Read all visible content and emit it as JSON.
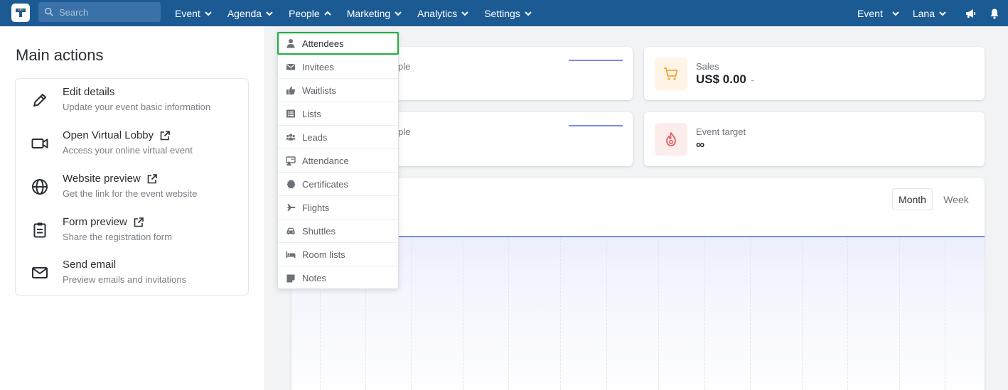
{
  "search": {
    "placeholder": "Search"
  },
  "nav": {
    "event": "Event",
    "agenda": "Agenda",
    "people": "People",
    "marketing": "Marketing",
    "analytics": "Analytics",
    "settings": "Settings"
  },
  "right_nav": {
    "event": "Event",
    "user": "Lana"
  },
  "main_actions": {
    "title": "Main actions",
    "items": [
      {
        "title": "Edit details",
        "subtitle": "Update your event basic information",
        "icon": "pencil-icon"
      },
      {
        "title": "Open Virtual Lobby",
        "subtitle": "Access your online virtual event",
        "icon": "video-camera-icon",
        "external": true
      },
      {
        "title": "Website preview",
        "subtitle": "Get the link for the event website",
        "icon": "globe-icon",
        "external": true
      },
      {
        "title": "Form preview",
        "subtitle": "Share the registration form",
        "icon": "clipboard-icon",
        "external": true
      },
      {
        "title": "Send email",
        "subtitle": "Preview emails and invitations",
        "icon": "envelope-icon"
      }
    ]
  },
  "cards": {
    "c1_label_tail": "ple",
    "c3_label_tail": "ple",
    "sales": {
      "label": "Sales",
      "value": "US$ 0.00",
      "trend": "-"
    },
    "target": {
      "label": "Event target",
      "value": "∞"
    }
  },
  "chart": {
    "month": "Month",
    "week": "Week"
  },
  "people_menu": [
    {
      "label": "Attendees",
      "icon": "user-icon",
      "active": true
    },
    {
      "label": "Invitees",
      "icon": "envelope-icon"
    },
    {
      "label": "Waitlists",
      "icon": "thumbs-up-icon"
    },
    {
      "label": "Lists",
      "icon": "list-icon"
    },
    {
      "label": "Leads",
      "icon": "users-icon"
    },
    {
      "label": "Attendance",
      "icon": "id-card-icon"
    },
    {
      "label": "Certificates",
      "icon": "certificate-icon"
    },
    {
      "label": "Flights",
      "icon": "plane-icon"
    },
    {
      "label": "Shuttles",
      "icon": "car-icon"
    },
    {
      "label": "Room lists",
      "icon": "bed-icon"
    },
    {
      "label": "Notes",
      "icon": "note-icon"
    }
  ],
  "colors": {
    "topbar": "#1c5a94",
    "accent_green": "#1fae3f",
    "chart_line": "#7a8be3",
    "sales_icon": "#f3a53b",
    "target_icon": "#e85c5c"
  }
}
